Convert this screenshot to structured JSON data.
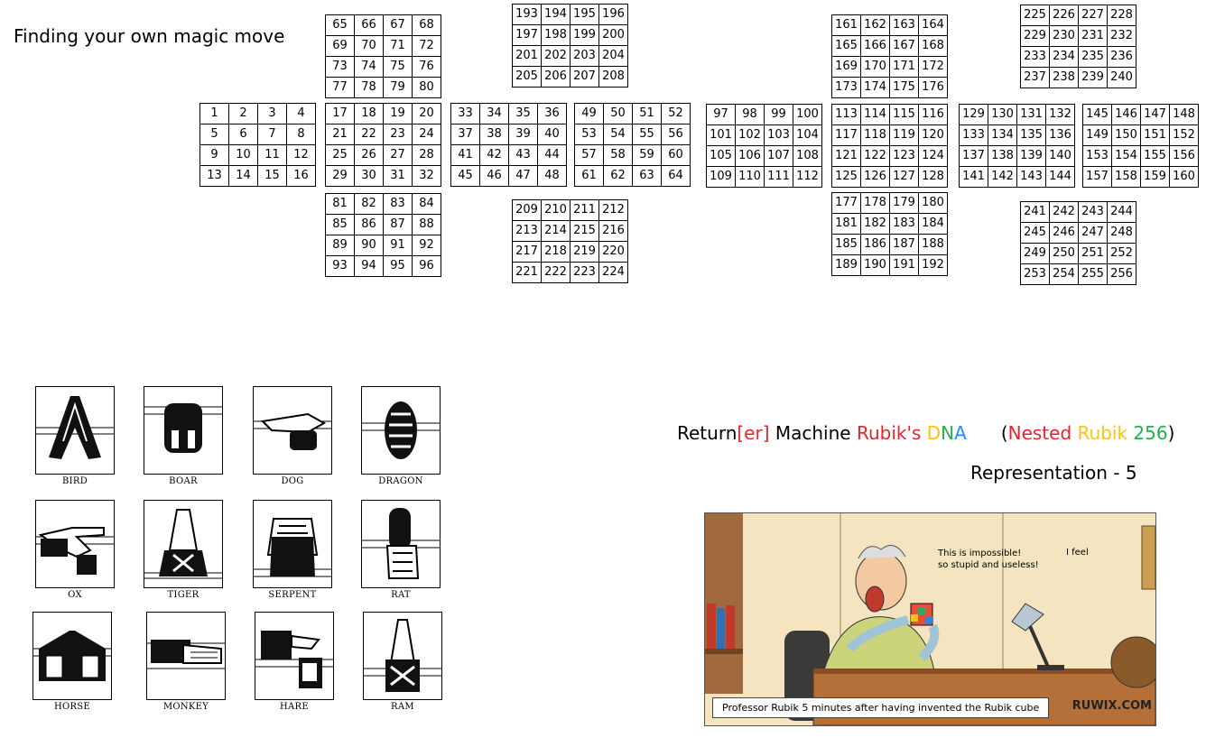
{
  "heading": "Finding your own magic move",
  "colors": {
    "red": "#e8232d",
    "yellow": "#ffc20e",
    "blue": "#1f8fff",
    "green": "#22b14c",
    "comic_wall": "#f4e4bf"
  },
  "grids": [
    {
      "id": "g1",
      "rows": [
        [
          "1",
          "2",
          "3",
          "4"
        ],
        [
          "5",
          "6",
          "7",
          "8"
        ],
        [
          "9",
          "10",
          "11",
          "12"
        ],
        [
          "13",
          "14",
          "15",
          "16"
        ]
      ]
    },
    {
      "id": "g2",
      "rows": [
        [
          "17",
          "18",
          "19",
          "20"
        ],
        [
          "21",
          "22",
          "23",
          "24"
        ],
        [
          "25",
          "26",
          "27",
          "28"
        ],
        [
          "29",
          "30",
          "31",
          "32"
        ]
      ]
    },
    {
      "id": "g3",
      "rows": [
        [
          "33",
          "34",
          "35",
          "36"
        ],
        [
          "37",
          "38",
          "39",
          "40"
        ],
        [
          "41",
          "42",
          "43",
          "44"
        ],
        [
          "45",
          "46",
          "47",
          "48"
        ]
      ]
    },
    {
      "id": "g4",
      "rows": [
        [
          "49",
          "50",
          "51",
          "52"
        ],
        [
          "53",
          "54",
          "55",
          "56"
        ],
        [
          "57",
          "58",
          "59",
          "60"
        ],
        [
          "61",
          "62",
          "63",
          "64"
        ]
      ]
    },
    {
      "id": "g5",
      "rows": [
        [
          "65",
          "66",
          "67",
          "68"
        ],
        [
          "69",
          "70",
          "71",
          "72"
        ],
        [
          "73",
          "74",
          "75",
          "76"
        ],
        [
          "77",
          "78",
          "79",
          "80"
        ]
      ]
    },
    {
      "id": "g6",
      "rows": [
        [
          "81",
          "82",
          "83",
          "84"
        ],
        [
          "85",
          "86",
          "87",
          "88"
        ],
        [
          "89",
          "90",
          "91",
          "92"
        ],
        [
          "93",
          "94",
          "95",
          "96"
        ]
      ]
    },
    {
      "id": "g7",
      "rows": [
        [
          "97",
          "98",
          "99",
          "100"
        ],
        [
          "101",
          "102",
          "103",
          "104"
        ],
        [
          "105",
          "106",
          "107",
          "108"
        ],
        [
          "109",
          "110",
          "111",
          "112"
        ]
      ]
    },
    {
      "id": "g8",
      "rows": [
        [
          "113",
          "114",
          "115",
          "116"
        ],
        [
          "117",
          "118",
          "119",
          "120"
        ],
        [
          "121",
          "122",
          "123",
          "124"
        ],
        [
          "125",
          "126",
          "127",
          "128"
        ]
      ]
    },
    {
      "id": "g9",
      "rows": [
        [
          "129",
          "130",
          "131",
          "132"
        ],
        [
          "133",
          "134",
          "135",
          "136"
        ],
        [
          "137",
          "138",
          "139",
          "140"
        ],
        [
          "141",
          "142",
          "143",
          "144"
        ]
      ]
    },
    {
      "id": "g10",
      "rows": [
        [
          "145",
          "146",
          "147",
          "148"
        ],
        [
          "149",
          "150",
          "151",
          "152"
        ],
        [
          "153",
          "154",
          "155",
          "156"
        ],
        [
          "157",
          "158",
          "159",
          "160"
        ]
      ]
    },
    {
      "id": "g11",
      "rows": [
        [
          "161",
          "162",
          "163",
          "164"
        ],
        [
          "165",
          "166",
          "167",
          "168"
        ],
        [
          "169",
          "170",
          "171",
          "172"
        ],
        [
          "173",
          "174",
          "175",
          "176"
        ]
      ]
    },
    {
      "id": "g12",
      "rows": [
        [
          "177",
          "178",
          "179",
          "180"
        ],
        [
          "181",
          "182",
          "183",
          "184"
        ],
        [
          "185",
          "186",
          "187",
          "188"
        ],
        [
          "189",
          "190",
          "191",
          "192"
        ]
      ]
    },
    {
      "id": "g13",
      "rows": [
        [
          "193",
          "194",
          "195",
          "196"
        ],
        [
          "197",
          "198",
          "199",
          "200"
        ],
        [
          "201",
          "202",
          "203",
          "204"
        ],
        [
          "205",
          "206",
          "207",
          "208"
        ]
      ]
    },
    {
      "id": "g14",
      "rows": [
        [
          "209",
          "210",
          "211",
          "212"
        ],
        [
          "213",
          "214",
          "215",
          "216"
        ],
        [
          "217",
          "218",
          "219",
          "220"
        ],
        [
          "221",
          "222",
          "223",
          "224"
        ]
      ]
    },
    {
      "id": "g15",
      "rows": [
        [
          "225",
          "226",
          "227",
          "228"
        ],
        [
          "229",
          "230",
          "231",
          "232"
        ],
        [
          "233",
          "234",
          "235",
          "236"
        ],
        [
          "237",
          "238",
          "239",
          "240"
        ]
      ]
    },
    {
      "id": "g16",
      "rows": [
        [
          "241",
          "242",
          "243",
          "244"
        ],
        [
          "245",
          "246",
          "247",
          "248"
        ],
        [
          "249",
          "250",
          "251",
          "252"
        ],
        [
          "253",
          "254",
          "255",
          "256"
        ]
      ]
    }
  ],
  "hand_seals": [
    {
      "label": "BIRD"
    },
    {
      "label": "BOAR"
    },
    {
      "label": "DOG"
    },
    {
      "label": "DRAGON"
    },
    {
      "label": "OX"
    },
    {
      "label": "TIGER"
    },
    {
      "label": "SERPENT"
    },
    {
      "label": "RAT"
    },
    {
      "label": "HORSE"
    },
    {
      "label": "MONKEY"
    },
    {
      "label": "HARE"
    },
    {
      "label": "RAM"
    }
  ],
  "dna_title": {
    "part1": "Return",
    "part2": "[er]",
    "part3": " Machine ",
    "part4": "Rubik's ",
    "part5": "D",
    "part6": "N",
    "part7": "A",
    "part8": "(",
    "part9": "Nested",
    "part10": " Rubik",
    "part11": " 256",
    "part12": ")"
  },
  "representation": "Representation - 5",
  "comic": {
    "speech1_line1": "This is impossible!",
    "speech1_line2": "so stupid and useless!",
    "speech2": "I feel",
    "caption": "Professor Rubik 5 minutes after having invented the Rubik cube",
    "brand": "RUWIX.COM"
  }
}
